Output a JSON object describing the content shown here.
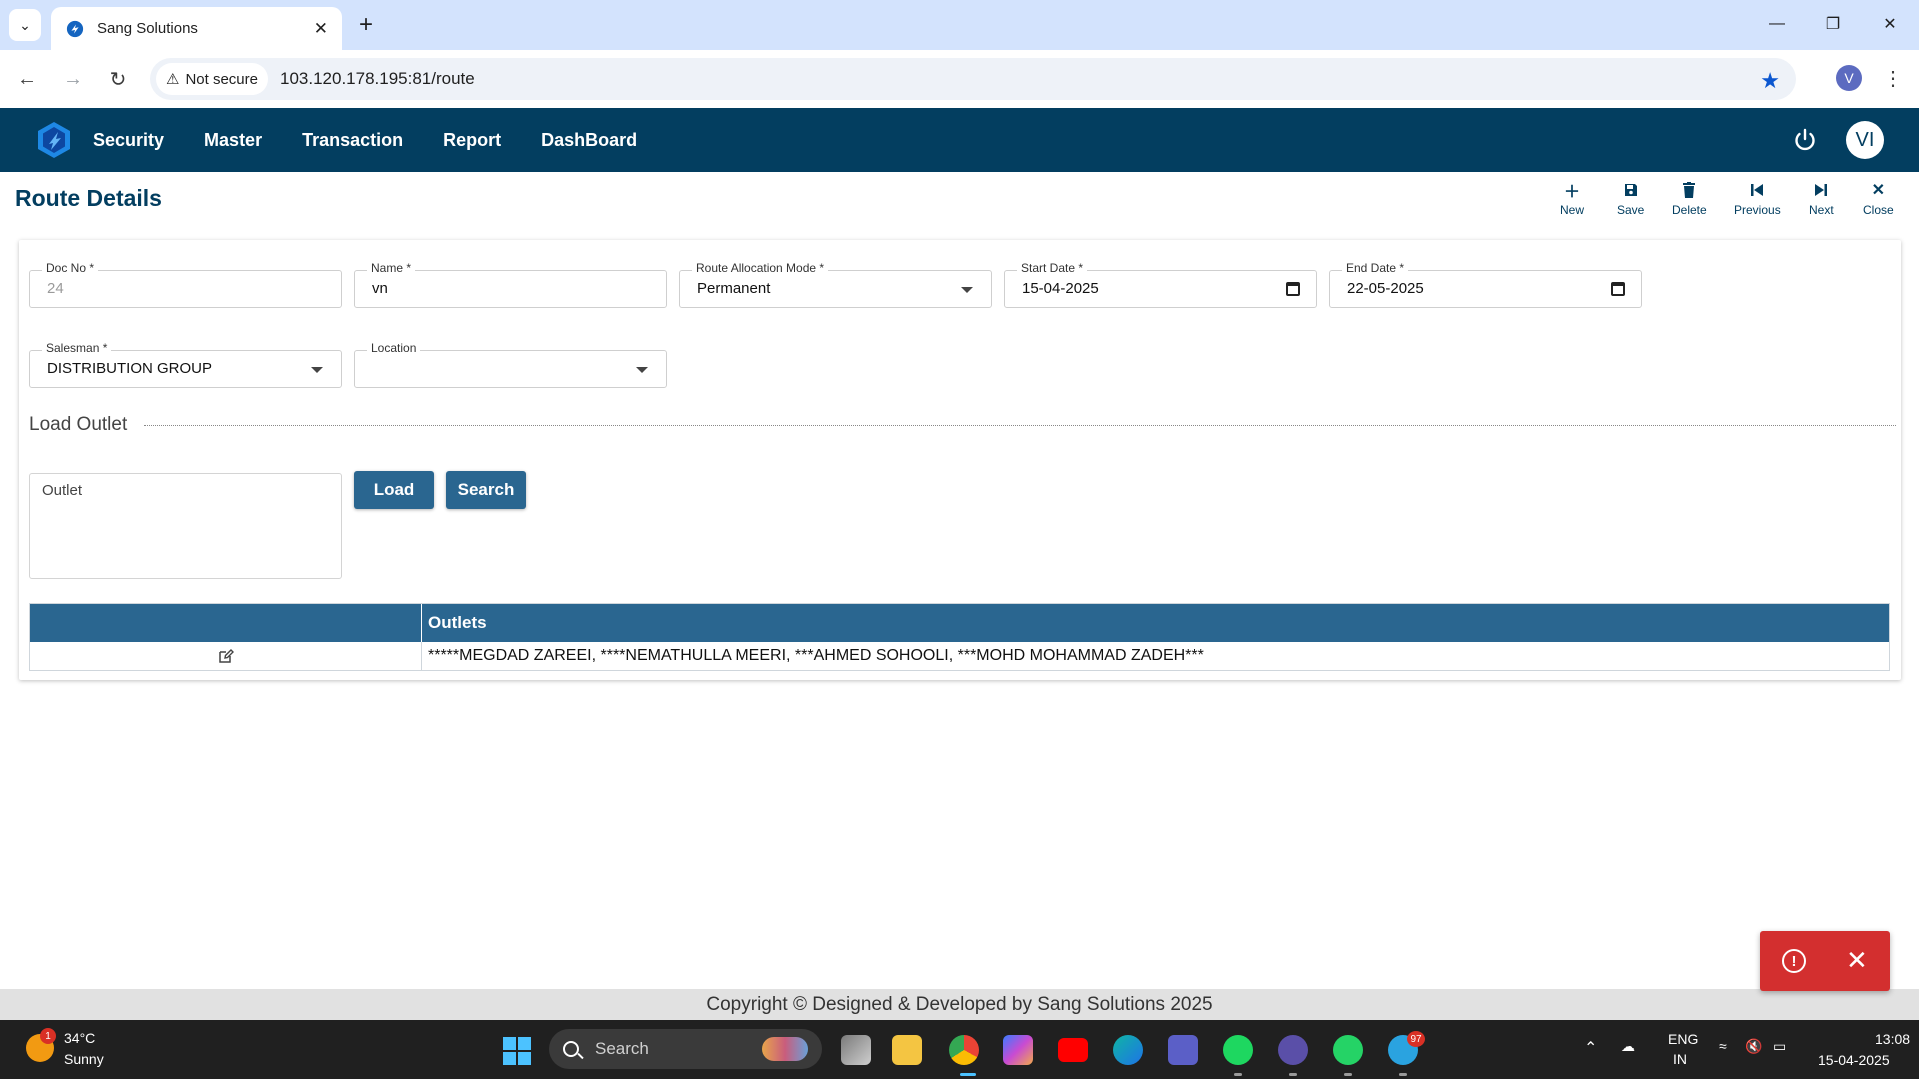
{
  "browser": {
    "tab_title": "Sang Solutions",
    "security_label": "Not secure",
    "url": "103.120.178.195:81/route",
    "profile_initial": "V"
  },
  "app": {
    "nav": [
      "Security",
      "Master",
      "Transaction",
      "Report",
      "DashBoard"
    ],
    "user_initials": "VI",
    "colors": {
      "header": "#033e60",
      "accent": "#2a6690",
      "error": "#d32f2f"
    }
  },
  "page": {
    "title": "Route Details",
    "actions": [
      {
        "label": "New",
        "icon": "plus-icon"
      },
      {
        "label": "Save",
        "icon": "save-icon"
      },
      {
        "label": "Delete",
        "icon": "trash-icon"
      },
      {
        "label": "Previous",
        "icon": "skip-previous-icon"
      },
      {
        "label": "Next",
        "icon": "skip-next-icon"
      },
      {
        "label": "Close",
        "icon": "close-icon"
      }
    ]
  },
  "form": {
    "doc_no": {
      "label": "Doc No *",
      "value": "24"
    },
    "name": {
      "label": "Name *",
      "value": "vn"
    },
    "route_allocation_mode": {
      "label": "Route Allocation Mode *",
      "value": "Permanent"
    },
    "start_date": {
      "label": "Start Date *",
      "value": "15-04-2025"
    },
    "end_date": {
      "label": "End Date *",
      "value": "22-05-2025"
    },
    "salesman": {
      "label": "Salesman *",
      "value": "DISTRIBUTION GROUP"
    },
    "location": {
      "label": "Location",
      "value": ""
    }
  },
  "load_outlet": {
    "legend": "Load Outlet",
    "outlet_placeholder": "Outlet",
    "load_label": "Load",
    "search_label": "Search"
  },
  "grid": {
    "columns": [
      "",
      "Outlets"
    ],
    "rows": [
      {
        "outlets": "*****MEGDAD ZAREEI, ****NEMATHULLA MEERI, ***AHMED SOHOOLI, ***MOHD MOHAMMAD ZADEH***"
      }
    ]
  },
  "footer": {
    "text": "Copyright © Designed & Developed by Sang Solutions 2025"
  },
  "taskbar": {
    "weather_temp": "34°C",
    "weather_condition": "Sunny",
    "weather_badge": "1",
    "search_label": "Search",
    "telegram_badge": "97",
    "language": "ENG",
    "region": "IN",
    "time": "13:08",
    "date": "15-04-2025"
  }
}
